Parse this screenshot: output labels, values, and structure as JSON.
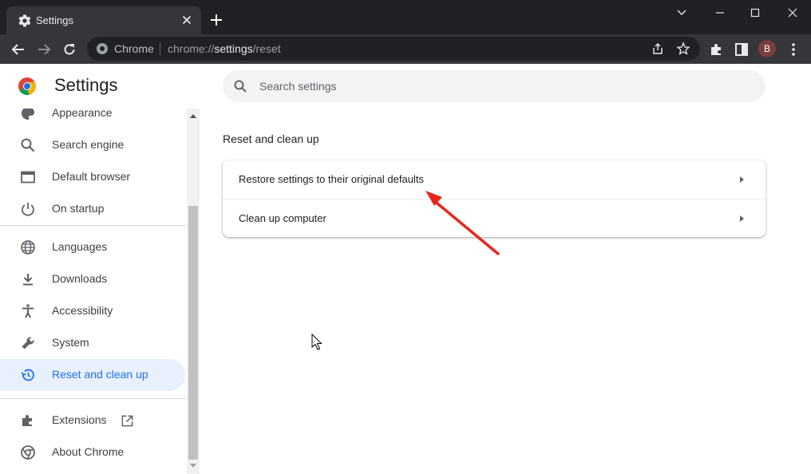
{
  "tab": {
    "title": "Settings"
  },
  "toolbar": {
    "site_label": "Chrome",
    "url_scheme": "chrome://",
    "url_host": "settings",
    "url_path": "/reset",
    "avatar_initial": "B"
  },
  "page": {
    "title": "Settings",
    "search_placeholder": "Search settings"
  },
  "sidebar": {
    "items": [
      {
        "label": "Appearance",
        "icon": "palette-icon"
      },
      {
        "label": "Search engine",
        "icon": "search-icon"
      },
      {
        "label": "Default browser",
        "icon": "browser-window-icon"
      },
      {
        "label": "On startup",
        "icon": "power-icon"
      },
      {
        "label": "Languages",
        "icon": "globe-icon"
      },
      {
        "label": "Downloads",
        "icon": "download-icon"
      },
      {
        "label": "Accessibility",
        "icon": "accessibility-icon"
      },
      {
        "label": "System",
        "icon": "wrench-icon"
      },
      {
        "label": "Reset and clean up",
        "icon": "restore-icon",
        "active": true
      },
      {
        "label": "Extensions",
        "icon": "puzzle-icon"
      },
      {
        "label": "About Chrome",
        "icon": "chrome-icon"
      }
    ]
  },
  "main": {
    "section_title": "Reset and clean up",
    "rows": [
      {
        "label": "Restore settings to their original defaults"
      },
      {
        "label": "Clean up computer"
      }
    ]
  },
  "colors": {
    "accent": "#1a73e8",
    "active_bg": "#e8f0fe",
    "annotation_arrow": "#e8251b",
    "titlebar": "#202124",
    "toolbar": "#35363a"
  }
}
